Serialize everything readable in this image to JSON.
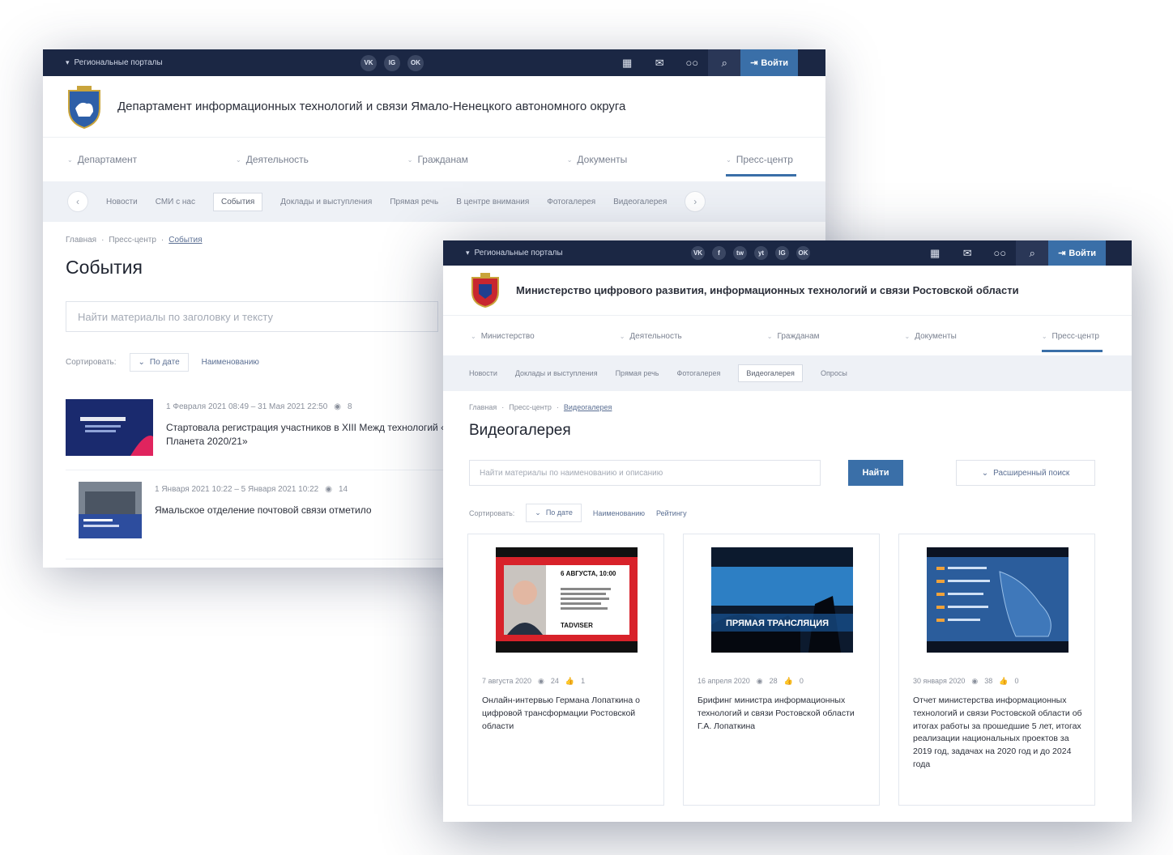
{
  "window_a": {
    "portals_label": "Региональные порталы",
    "social": [
      "VK",
      "IG",
      "OK"
    ],
    "login_label": "Войти",
    "org_name": "Департамент информационных технологий и связи Ямало-Ненецкого автономного округа",
    "nav": [
      "Департамент",
      "Деятельность",
      "Гражданам",
      "Документы",
      "Пресс-центр"
    ],
    "subnav": [
      "Новости",
      "СМИ с нас",
      "События",
      "Доклады и выступления",
      "Прямая речь",
      "В центре внимания",
      "Фотогалерея",
      "Видеогалерея"
    ],
    "breadcrumbs": [
      "Главная",
      "Пресс-центр",
      "События"
    ],
    "title": "События",
    "search_placeholder": "Найти материалы по заголовку и тексту",
    "sort_label": "Сортировать:",
    "sort_selected": "По дате",
    "sort_option": "Наименованию",
    "events": [
      {
        "date": "1 Февраля 2021 08:49 – 31 Мая 2021 22:50",
        "views": "8",
        "title": "Стартовала регистрация участников в XIII Межд технологий «IT-Планета 2020/21»"
      },
      {
        "date": "1 Января 2021 10:22 – 5 Января 2021 10:22",
        "views": "14",
        "title": "Ямальское отделение почтовой связи отметило"
      }
    ]
  },
  "window_b": {
    "portals_label": "Региональные порталы",
    "social": [
      "VK",
      "f",
      "tw",
      "yt",
      "IG",
      "OK"
    ],
    "login_label": "Войти",
    "org_name": "Министерство цифрового развития, информационных технологий и связи Ростовской области",
    "nav": [
      "Министерство",
      "Деятельность",
      "Гражданам",
      "Документы",
      "Пресс-центр"
    ],
    "subnav": [
      "Новости",
      "Доклады и выступления",
      "Прямая речь",
      "Фотогалерея",
      "Видеогалерея",
      "Опросы"
    ],
    "breadcrumbs": [
      "Главная",
      "Пресс-центр",
      "Видеогалерея"
    ],
    "title": "Видеогалерея",
    "search_placeholder": "Найти материалы по наименованию и описанию",
    "find_label": "Найти",
    "advanced_label": "Расширенный поиск",
    "sort_label": "Сортировать:",
    "sort_selected": "По дате",
    "sort_options": [
      "Наименованию",
      "Рейтингу"
    ],
    "videos": [
      {
        "date": "7 августа 2020",
        "views": "24",
        "likes": "1",
        "title": "Онлайн-интервью Германа Лопаткина о цифровой трансформации Ростовской области",
        "thumb_heading": "6 АВГУСТА, 10:00",
        "thumb_brand": "TADVISER"
      },
      {
        "date": "16 апреля 2020",
        "views": "28",
        "likes": "0",
        "title": "Брифинг министра информационных технологий и связи Ростовской области Г.А. Лопаткина",
        "thumb_caption": "ПРЯМАЯ ТРАНСЛЯЦИЯ"
      },
      {
        "date": "30 января 2020",
        "views": "38",
        "likes": "0",
        "title": "Отчет министерства информационных технологий и связи Ростовской области об итогах работы за прошедшие 5 лет, итогах реализации национальных проектов за 2019 год, задачах на 2020 год и до 2024 года"
      }
    ]
  }
}
